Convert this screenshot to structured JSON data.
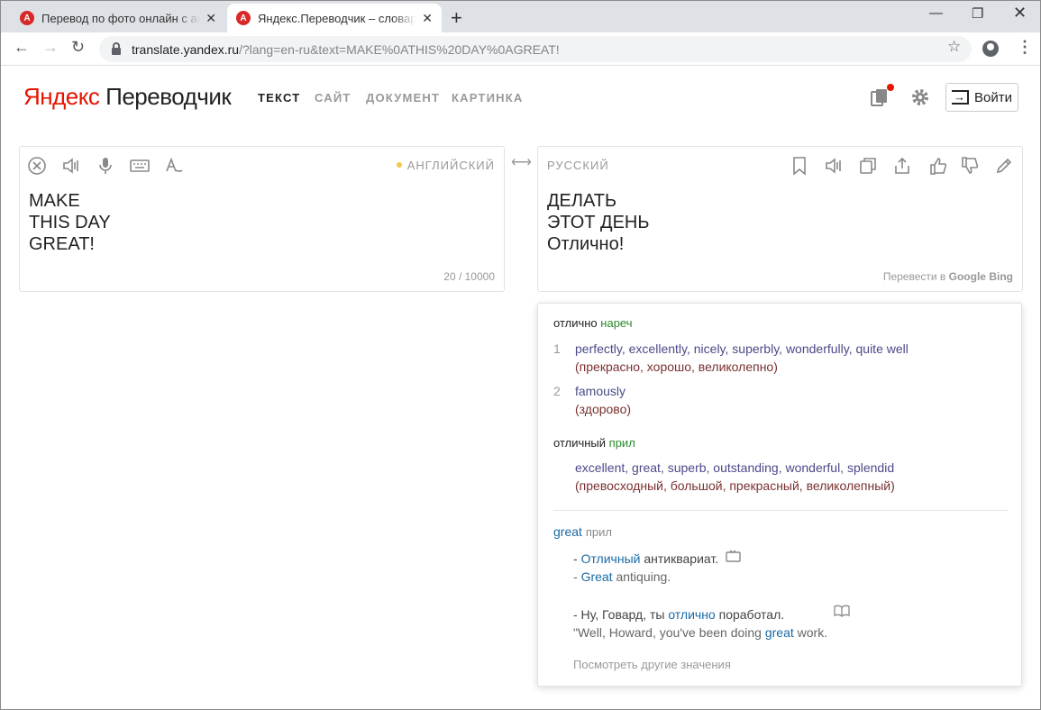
{
  "browser": {
    "tabs": [
      {
        "title": "Перевод по фото онлайн с англ",
        "favicon": "yandex-translate-icon"
      },
      {
        "title": "Яндекс.Переводчик – словарь и",
        "favicon": "yandex-translate-icon"
      }
    ],
    "url_host": "translate.yandex.ru",
    "url_rest": "/?lang=en-ru&text=MAKE%0ATHIS%20DAY%0AGREAT!"
  },
  "header": {
    "logo_ya": "Яндекс",
    "logo_rest": " Переводчик",
    "nav": [
      "ТЕКСТ",
      "САЙТ",
      "ДОКУМЕНТ",
      "КАРТИНКА"
    ],
    "login_label": "Войти"
  },
  "source": {
    "lang": "АНГЛИЙСКИЙ",
    "text": "MAKE\nTHIS DAY\nGREAT!",
    "counter": "20 / 10000"
  },
  "target": {
    "lang": "РУССКИЙ",
    "text": "ДЕЛАТЬ\nЭТОТ ДЕНЬ\nОтлично!",
    "translate_in": "Перевести в",
    "google": "Google",
    "bing": "Bing"
  },
  "dictionary": {
    "entry1": {
      "word": "отлично",
      "pos": "нареч",
      "senses": [
        {
          "num": "1",
          "translations": "perfectly, excellently, nicely, superbly, wonderfully, quite well",
          "meaning": "(прекрасно, хорошо, великолепно)"
        },
        {
          "num": "2",
          "translations": "famously",
          "meaning": "(здорово)"
        }
      ]
    },
    "entry2": {
      "word": "отличный",
      "pos": "прил",
      "translations": "excellent, great, superb, outstanding, wonderful, splendid",
      "meaning": "(превосходный, большой, прекрасный, великолепный)"
    },
    "examples": {
      "word": "great",
      "pos": "прил",
      "ex1_ru_pre": "- ",
      "ex1_ru_hl": "Отличный",
      "ex1_ru_post": " антиквариат.",
      "ex1_en_pre": "- ",
      "ex1_en_hl": "Great",
      "ex1_en_post": " antiquing.",
      "ex2_ru_pre": "- Ну, Говард, ты ",
      "ex2_ru_hl": "отлично",
      "ex2_ru_post": " поработал.",
      "ex2_en_pre": "\"Well, Howard, you've been doing ",
      "ex2_en_hl": "great",
      "ex2_en_post": " work.",
      "more": "Посмотреть другие значения"
    }
  }
}
